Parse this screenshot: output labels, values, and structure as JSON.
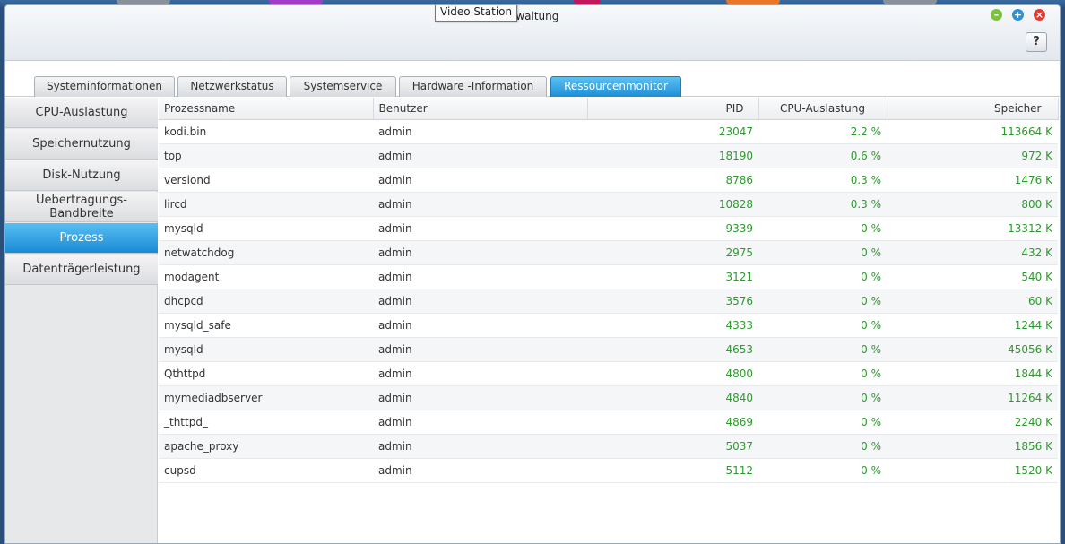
{
  "window": {
    "title_partial": "erwaltung",
    "tooltip": "Video Station",
    "help_label": "?"
  },
  "tabs": [
    {
      "label": "Systeminformationen",
      "active": false
    },
    {
      "label": "Netzwerkstatus",
      "active": false
    },
    {
      "label": "Systemservice",
      "active": false
    },
    {
      "label": "Hardware -Information",
      "active": false
    },
    {
      "label": "Ressourcenmonitor",
      "active": true
    }
  ],
  "sidebar": {
    "items": [
      {
        "label": "CPU-Auslastung",
        "active": false
      },
      {
        "label": "Speichernutzung",
        "active": false
      },
      {
        "label": "Disk-Nutzung",
        "active": false
      },
      {
        "label": "Uebertragungs-Bandbreite",
        "active": false
      },
      {
        "label": "Prozess",
        "active": true
      },
      {
        "label": "Datenträgerleistung",
        "active": false
      }
    ]
  },
  "table": {
    "columns": [
      "Prozessname",
      "Benutzer",
      "PID",
      "CPU-Auslastung",
      "Speicher"
    ],
    "rows": [
      {
        "name": "kodi.bin",
        "user": "admin",
        "pid": "23047",
        "cpu": "2.2 %",
        "mem": "113664 K"
      },
      {
        "name": "top",
        "user": "admin",
        "pid": "18190",
        "cpu": "0.6 %",
        "mem": "972 K"
      },
      {
        "name": "versiond",
        "user": "admin",
        "pid": "8786",
        "cpu": "0.3 %",
        "mem": "1476 K"
      },
      {
        "name": "lircd",
        "user": "admin",
        "pid": "10828",
        "cpu": "0.3 %",
        "mem": "800 K"
      },
      {
        "name": "mysqld",
        "user": "admin",
        "pid": "9339",
        "cpu": "0 %",
        "mem": "13312 K"
      },
      {
        "name": "netwatchdog",
        "user": "admin",
        "pid": "2975",
        "cpu": "0 %",
        "mem": "432 K"
      },
      {
        "name": "modagent",
        "user": "admin",
        "pid": "3121",
        "cpu": "0 %",
        "mem": "540 K"
      },
      {
        "name": "dhcpcd",
        "user": "admin",
        "pid": "3576",
        "cpu": "0 %",
        "mem": "60 K"
      },
      {
        "name": "mysqld_safe",
        "user": "admin",
        "pid": "4333",
        "cpu": "0 %",
        "mem": "1244 K"
      },
      {
        "name": "mysqld",
        "user": "admin",
        "pid": "4653",
        "cpu": "0 %",
        "mem": "45056 K"
      },
      {
        "name": "Qthttpd",
        "user": "admin",
        "pid": "4800",
        "cpu": "0 %",
        "mem": "1844 K"
      },
      {
        "name": "mymediadbserver",
        "user": "admin",
        "pid": "4840",
        "cpu": "0 %",
        "mem": "11264 K"
      },
      {
        "name": "_thttpd_",
        "user": "admin",
        "pid": "4869",
        "cpu": "0 %",
        "mem": "2240 K"
      },
      {
        "name": "apache_proxy",
        "user": "admin",
        "pid": "5037",
        "cpu": "0 %",
        "mem": "1856 K"
      },
      {
        "name": "cupsd",
        "user": "admin",
        "pid": "5112",
        "cpu": "0 %",
        "mem": "1520 K"
      }
    ]
  },
  "colors": {
    "accent_blue": "#1d8fd6",
    "value_green": "#2d9a2d"
  }
}
